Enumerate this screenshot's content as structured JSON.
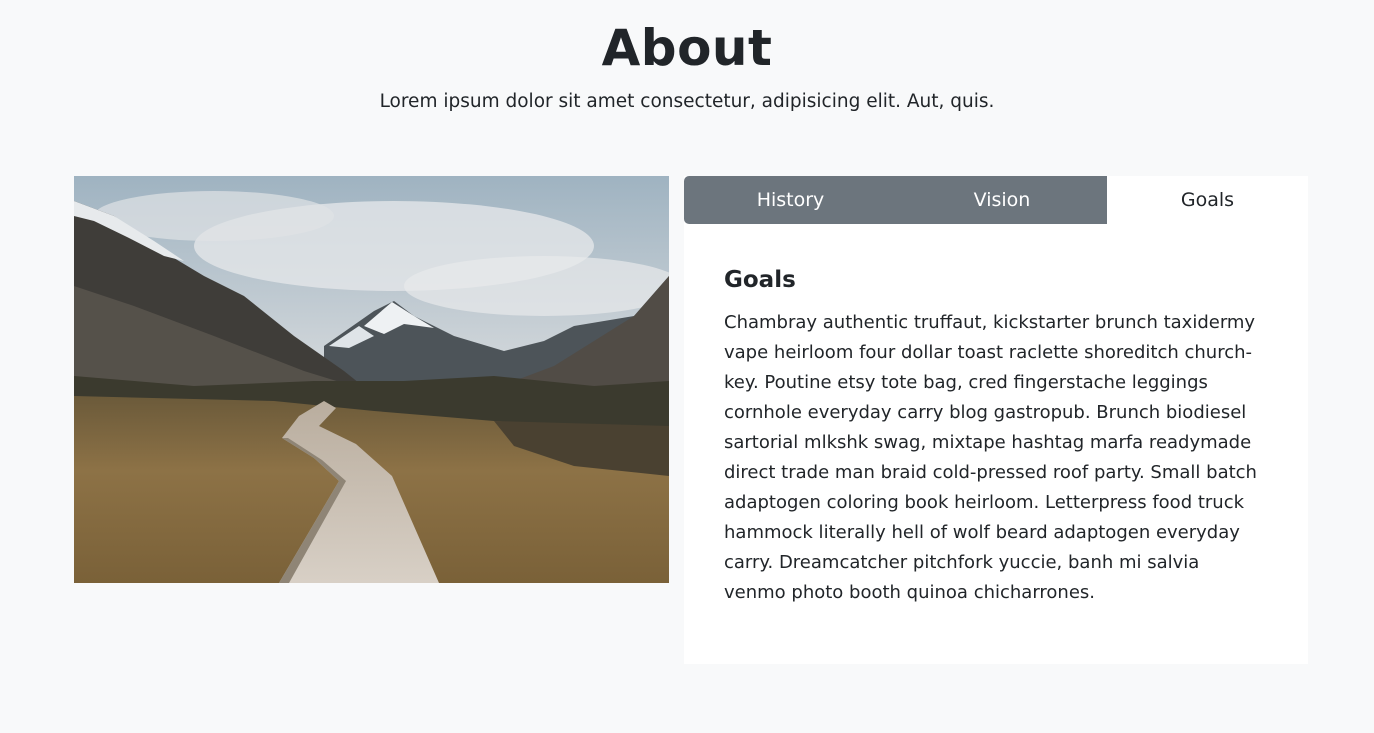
{
  "header": {
    "title": "About",
    "subtitle": "Lorem ipsum dolor sit amet consectetur, adipisicing elit. Aut, quis."
  },
  "image": {
    "description_icon": "landscape-photo"
  },
  "tabs": {
    "items": [
      {
        "label": "History",
        "active": false
      },
      {
        "label": "Vision",
        "active": false
      },
      {
        "label": "Goals",
        "active": true
      }
    ],
    "inactive_color": "#6c757d",
    "active_color": "#ffffff"
  },
  "content": {
    "heading": "Goals",
    "body": "Chambray authentic truffaut, kickstarter brunch taxidermy vape heirloom four dollar toast raclette shoreditch church-key. Poutine etsy tote bag, cred fingerstache leggings cornhole everyday carry blog gastropub. Brunch biodiesel sartorial mlkshk swag, mixtape hashtag marfa readymade direct trade man braid cold-pressed roof party. Small batch adaptogen coloring book heirloom. Letterpress food truck hammock literally hell of wolf beard adaptogen everyday carry. Dreamcatcher pitchfork yuccie, banh mi salvia venmo photo booth quinoa chicharrones."
  }
}
